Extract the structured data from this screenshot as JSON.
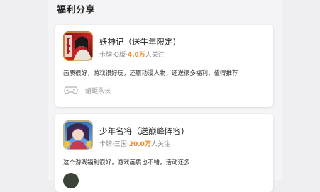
{
  "section": {
    "title": "福利分享"
  },
  "cards": [
    {
      "icon": "yaoshenji-game-icon",
      "name": "妖神记（送牛年限定)",
      "meta_prefix": "卡牌·Q版·",
      "meta_hot": "4.0万",
      "meta_suffix": "人关注",
      "description": "画质很好，游戏很好玩，还原动漫人物，还送很多福利，值得推荐",
      "user": {
        "name": "蜻蜓队长",
        "avatar_icon": "game-controller-icon"
      }
    },
    {
      "icon": "shaonian-mingjiang-game-icon",
      "name": "少年名将（送巅峰阵容)",
      "meta_prefix": "卡牌·三国·",
      "meta_hot": "20.0万",
      "meta_suffix": "人关注",
      "description": "这个游戏福利很好，游戏画质也不错，活动还多",
      "user": {
        "name": "",
        "avatar_icon": "user-avatar"
      }
    }
  ],
  "colors": {
    "accent": "#f08a24",
    "page_bg": "#f4f4f6",
    "card_bg": "#ffffff"
  }
}
